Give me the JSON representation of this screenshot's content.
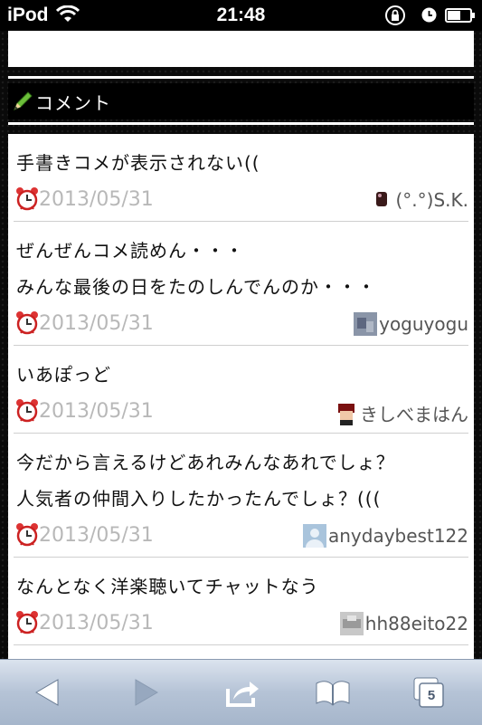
{
  "status_bar": {
    "carrier": "iPod",
    "time": "21:48"
  },
  "section": {
    "title": "コメント"
  },
  "comments": [
    {
      "lines": [
        "手書きコメが表示されない(("
      ],
      "date": "2013/05/31",
      "author": "(°.°)S.K."
    },
    {
      "lines": [
        "ぜんぜんコメ読めん・・・",
        "みんな最後の日をたのしんでんのか・・・"
      ],
      "date": "2013/05/31",
      "author": "yoguyogu"
    },
    {
      "lines": [
        "いあぽっど"
      ],
      "date": "2013/05/31",
      "author": "きしべまはん"
    },
    {
      "lines": [
        "今だから言えるけどあれみんなあれでしょ？",
        "人気者の仲間入りしたかったんでしょ？((("
      ],
      "date": "2013/05/31",
      "author": "anydaybest122"
    },
    {
      "lines": [
        "なんとなく洋楽聴いてチャットなう"
      ],
      "date": "2013/05/31",
      "author": "hh88eito22"
    }
  ],
  "toolbar": {
    "tabs_count": "5"
  },
  "colors": {
    "date_gray": "#b8b8b8",
    "toolbar_blue": "#b5c3d6"
  }
}
